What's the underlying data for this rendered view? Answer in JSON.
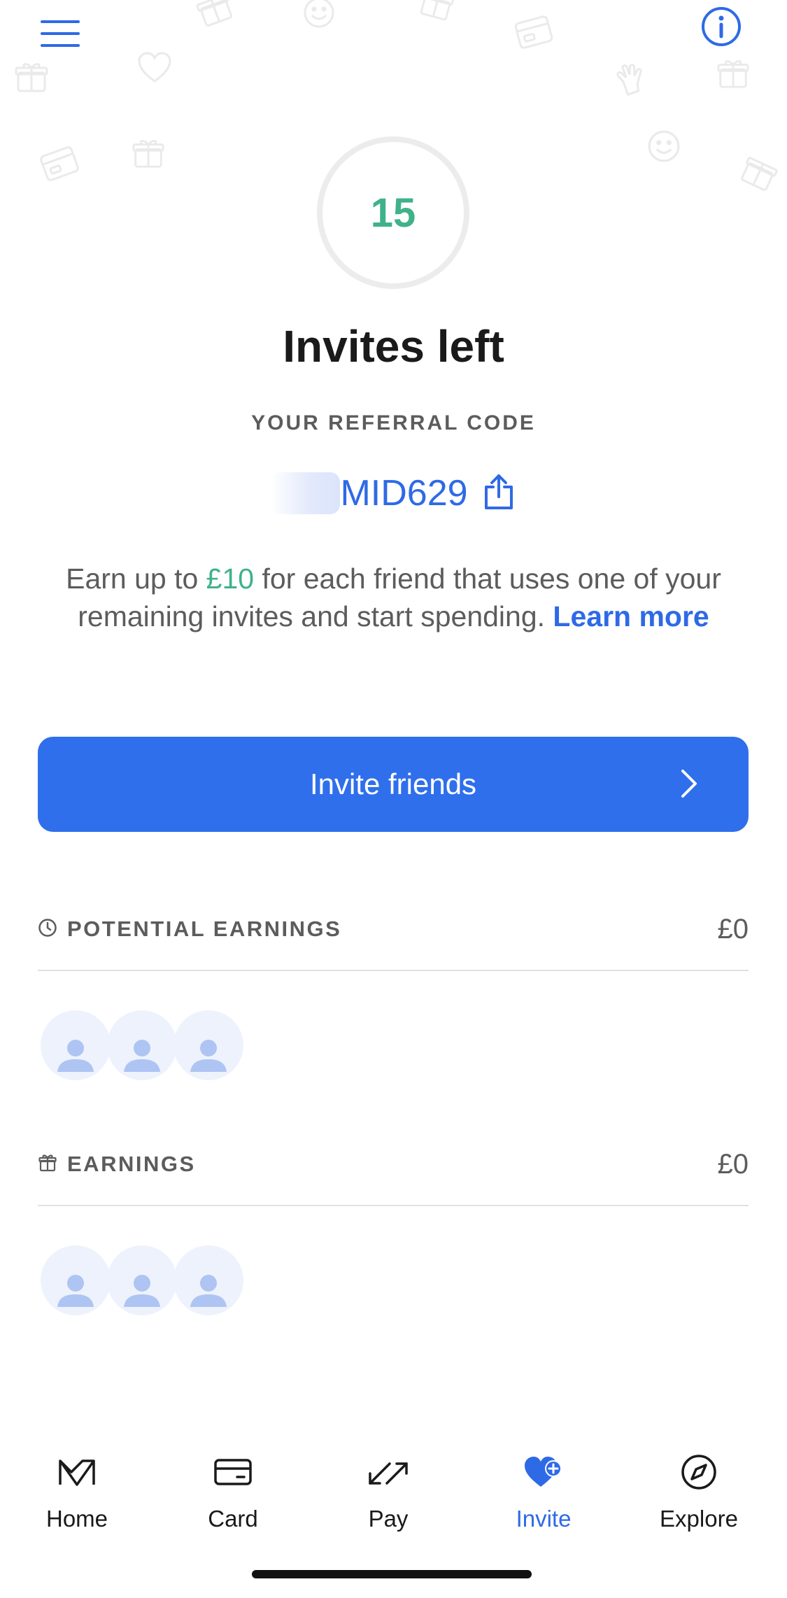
{
  "header": {
    "menu_icon": "hamburger-menu-icon",
    "info_icon": "info-icon"
  },
  "invites": {
    "count": "15",
    "title": "Invites left"
  },
  "referral": {
    "label": "YOUR REFERRAL CODE",
    "code_visible": "MID629",
    "share_icon": "share-icon"
  },
  "description": {
    "prefix": "Earn up to ",
    "amount": "£10",
    "suffix": " for each friend that uses one of your remaining invites and start spending. ",
    "learn_more": "Learn more"
  },
  "invite_button": {
    "label": "Invite friends"
  },
  "potential_earnings": {
    "label": "POTENTIAL EARNINGS",
    "value": "£0"
  },
  "earnings": {
    "label": "EARNINGS",
    "value": "£0"
  },
  "tabs": [
    {
      "label": "Home",
      "icon": "monzo-logo-icon",
      "active": false
    },
    {
      "label": "Card",
      "icon": "card-icon",
      "active": false
    },
    {
      "label": "Pay",
      "icon": "transfer-arrows-icon",
      "active": false
    },
    {
      "label": "Invite",
      "icon": "heart-plus-icon",
      "active": true
    },
    {
      "label": "Explore",
      "icon": "compass-icon",
      "active": false
    }
  ],
  "colors": {
    "accent_blue": "#2f6fec",
    "accent_green": "#3fb28a",
    "text_gray": "#5c5c5c"
  }
}
